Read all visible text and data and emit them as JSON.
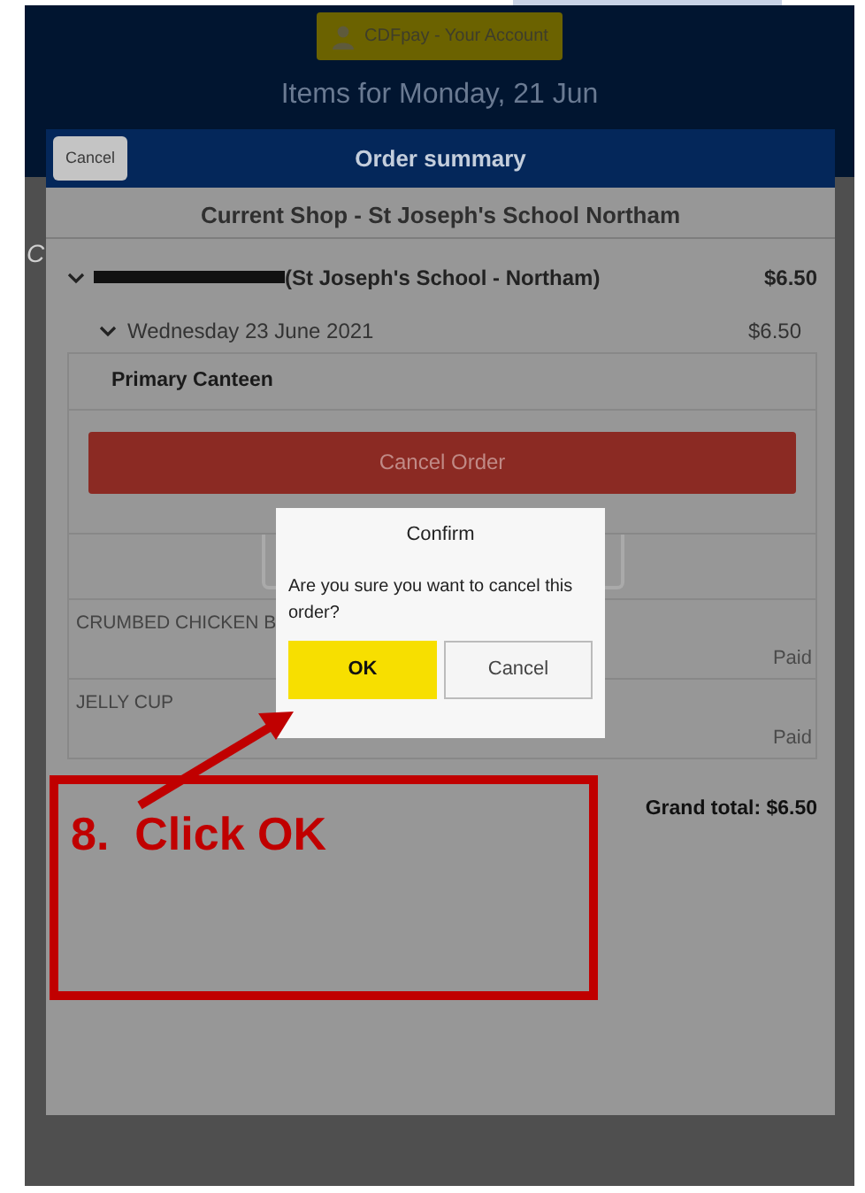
{
  "header": {
    "account_button": "CDFpay - Your Account",
    "title": "Items for Monday, 21 Jun"
  },
  "page_fragment": "C",
  "modal": {
    "cancel_button": "Cancel",
    "title": "Order summary",
    "shop": "Current Shop - St Joseph's School Northam",
    "student": {
      "redacted": true,
      "school": "(St Joseph's School - Northam)",
      "total": "$6.50",
      "expanded": true
    },
    "day": {
      "date": "Wednesday 23 June 2021",
      "total": "$6.50",
      "expanded": true
    },
    "canteen": "Primary Canteen",
    "cancel_order_button": "Cancel Order",
    "items": [
      {
        "name": "CRUMBED CHICKEN B",
        "status": "Paid"
      },
      {
        "name": "JELLY CUP",
        "status": "Paid"
      }
    ],
    "grand_total": "Grand total: $6.50"
  },
  "dialog": {
    "title": "Confirm",
    "message": "Are you sure you want to cancel this order?",
    "buttons": [
      {
        "label": "OK",
        "kind": "primary"
      },
      {
        "label": "Cancel",
        "kind": "secondary"
      }
    ]
  },
  "annotation": {
    "text": "8.  Click OK"
  }
}
